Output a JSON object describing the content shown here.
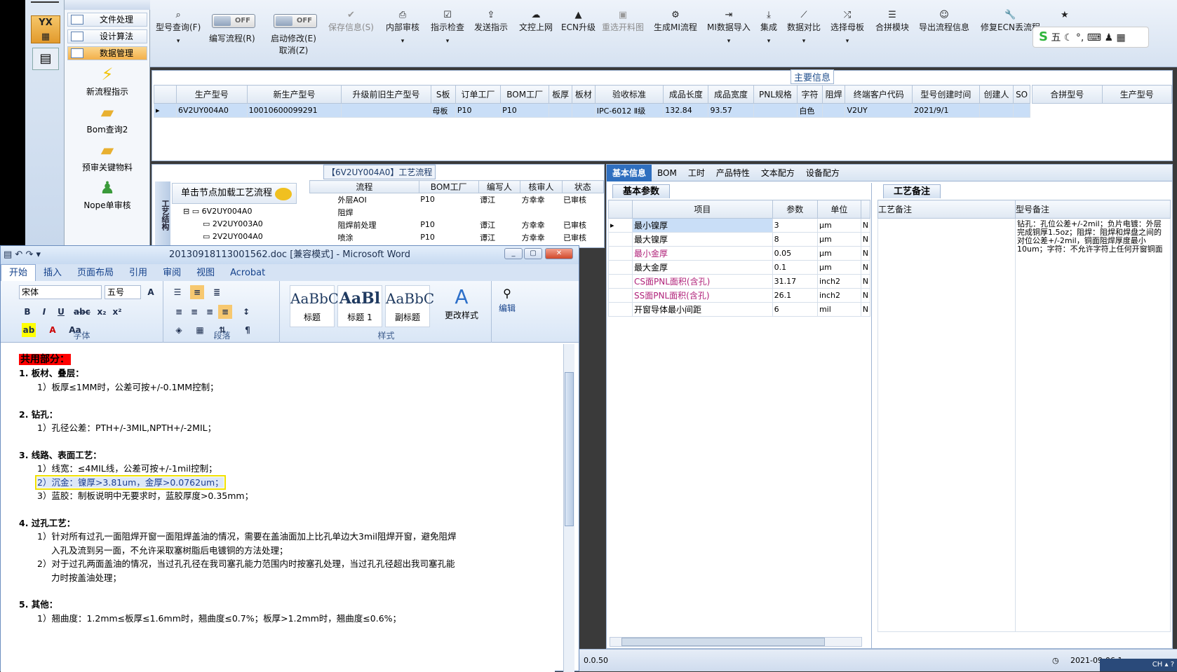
{
  "left_nav": {
    "items": [
      "文件处理",
      "设计算法",
      "数据管理"
    ],
    "active_index": 2,
    "big_items": [
      "新流程指示",
      "Bom查询2",
      "预审关键物料",
      "Nope单审核"
    ]
  },
  "toolbar": {
    "buttons": [
      {
        "label": "型号查询(F)",
        "icon": "search-icon",
        "disabled": false,
        "dropdown": true
      },
      {
        "label": "编写流程(R)",
        "icon": "toggle-icon",
        "disabled": false,
        "dropdown": false,
        "toggle": "OFF"
      },
      {
        "label": "启动修改(E)",
        "icon": "toggle-icon",
        "disabled": false,
        "dropdown": false,
        "toggle": "OFF",
        "sub": "取消(Z)"
      },
      {
        "label": "保存信息(S)",
        "icon": "check-icon",
        "disabled": true,
        "dropdown": false
      },
      {
        "label": "内部审核",
        "icon": "printer-icon",
        "disabled": false,
        "dropdown": true
      },
      {
        "label": "指示检查",
        "icon": "checkbox-icon",
        "disabled": false,
        "dropdown": true
      },
      {
        "label": "发送指示",
        "icon": "upload-icon",
        "disabled": false,
        "dropdown": false
      },
      {
        "label": "文控上网",
        "icon": "cloud-icon",
        "disabled": false,
        "dropdown": false
      },
      {
        "label": "ECN升级",
        "icon": "ecn-icon",
        "disabled": false,
        "dropdown": false
      },
      {
        "label": "重选开料图",
        "icon": "image-icon",
        "disabled": true,
        "dropdown": false
      },
      {
        "label": "生成MI流程",
        "icon": "gears-icon",
        "disabled": false,
        "dropdown": false
      },
      {
        "label": "MI数据导入",
        "icon": "import-icon",
        "disabled": false,
        "dropdown": true
      },
      {
        "label": "集成",
        "icon": "download-icon",
        "disabled": false,
        "dropdown": true
      },
      {
        "label": "数据对比",
        "icon": "compare-icon",
        "disabled": false,
        "dropdown": true
      },
      {
        "label": "选择母板",
        "icon": "shuffle-icon",
        "disabled": false,
        "dropdown": true
      },
      {
        "label": "合拼模块",
        "icon": "list-icon",
        "disabled": false,
        "dropdown": false
      },
      {
        "label": "导出流程信息",
        "icon": "smile-icon",
        "disabled": false,
        "dropdown": false
      },
      {
        "label": "修复ECN丢流程",
        "icon": "wrench-icon",
        "disabled": false,
        "dropdown": false
      },
      {
        "label": "",
        "icon": "star-icon",
        "disabled": false,
        "dropdown": true
      }
    ],
    "tray_text": "五"
  },
  "main_info": {
    "title": "主要信息",
    "columns": [
      "生产型号",
      "新生产型号",
      "升级前旧生产型号",
      "S板",
      "订单工厂",
      "BOM工厂",
      "板厚",
      "板材",
      "验收标准",
      "成品长度",
      "成品宽度",
      "PNL规格",
      "字符",
      "阻焊",
      "终端客户代码",
      "型号创建时间",
      "创建人",
      "SO"
    ],
    "row": [
      "6V2UY004A0",
      "10010600099291",
      "",
      "母板",
      "P10",
      "P10",
      "",
      "",
      "IPC-6012 Ⅱ级",
      "132.84",
      "93.57",
      "",
      "白色",
      "",
      "V2UY",
      "2021/9/1",
      "",
      ""
    ],
    "side_columns": [
      "合拼型号",
      "生产型号"
    ]
  },
  "flow": {
    "title": "【6V2UY004A0】工艺流程",
    "vertical_tab": "工艺结构",
    "load_button": "单击节点加载工艺流程",
    "tree": [
      "6V2UY004A0",
      "2V2UY003A0",
      "2V2UY004A0"
    ],
    "columns": [
      "流程",
      "BOM工厂",
      "编写人",
      "核审人",
      "状态"
    ],
    "rows": [
      {
        "name": "外层AOI",
        "factory": "P10",
        "writer": "谭江",
        "reviewer": "方幸幸",
        "status": "已审核"
      },
      {
        "name": "阻焊",
        "factory": "",
        "writer": "",
        "reviewer": "",
        "status": ""
      },
      {
        "name": "阻焊前处理",
        "factory": "P10",
        "writer": "谭江",
        "reviewer": "方幸幸",
        "status": "已审核"
      },
      {
        "name": "喷涂",
        "factory": "P10",
        "writer": "谭江",
        "reviewer": "方幸幸",
        "status": "已审核"
      }
    ]
  },
  "right": {
    "tabs": [
      "基本信息",
      "BOM",
      "工时",
      "产品特性",
      "文本配方",
      "设备配方"
    ],
    "active_tab": 0,
    "basic_title": "基本参数",
    "param_columns": [
      "项目",
      "参数",
      "单位"
    ],
    "params": [
      {
        "name": "最小镍厚",
        "value": "3",
        "unit": "μm",
        "flag": "N"
      },
      {
        "name": "最大镍厚",
        "value": "8",
        "unit": "μm",
        "flag": "N"
      },
      {
        "name": "最小金厚",
        "value": "0.05",
        "unit": "μm",
        "flag": "N"
      },
      {
        "name": "最大金厚",
        "value": "0.1",
        "unit": "μm",
        "flag": "N"
      },
      {
        "name": "CS面PNL面积(含孔)",
        "value": "31.17",
        "unit": "inch2",
        "flag": "N"
      },
      {
        "name": "SS面PNL面积(含孔)",
        "value": "26.1",
        "unit": "inch2",
        "flag": "N"
      },
      {
        "name": "开窗导体最小间距",
        "value": "6",
        "unit": "mil",
        "flag": "N"
      }
    ],
    "craft_title": "工艺备注",
    "craft_columns": [
      "工艺备注",
      "型号备注"
    ],
    "model_note": "钻孔：孔位公差+/-2mil；负片电镀：外层完成铜厚1.5oz；阻焊：阻焊和焊盘之间的对位公差+/-2mil，铜面阻焊厚度最小10um；字符：不允许字符上任何开窗铜面"
  },
  "word": {
    "title": "20130918113001562.doc [兼容模式] - Microsoft Word",
    "tabs": [
      "开始",
      "插入",
      "页面布局",
      "引用",
      "审阅",
      "视图",
      "Acrobat"
    ],
    "font": "宋体",
    "size": "五号",
    "groups": [
      "字体",
      "段落",
      "样式"
    ],
    "styles": [
      {
        "preview": "AaBbC",
        "name": "标题"
      },
      {
        "preview": "AaBl",
        "name": "标题 1"
      },
      {
        "preview": "AaBbC",
        "name": "副标题"
      }
    ],
    "change_style": "更改样式",
    "edit": "编辑",
    "doc": {
      "shared": "共用部分：",
      "sections": [
        {
          "heading": "1.  板材、叠层：",
          "lines": [
            "1）板厚≤1MM时，公差可按+/-0.1MM控制；"
          ]
        },
        {
          "heading": "2.  钻孔：",
          "lines": [
            "1）孔径公差：PTH+/-3MIL,NPTH+/-2MIL；"
          ]
        },
        {
          "heading": "3.  线路、表面工艺：",
          "lines": [
            "1）线宽：≤4MIL线，公差可按+/-1mil控制；",
            "2）沉金：镍厚>3.81um，金厚>0.0762um；",
            "3）蓝胶：制板说明中无要求时，蓝胶厚度>0.35mm；"
          ]
        },
        {
          "heading": "4.  过孔工艺：",
          "lines": [
            "1）针对所有过孔一面阻焊开窗一面阻焊盖油的情况，需要在盖油面加上比孔单边大3mil阻焊开窗，避免阻焊",
            "入孔及流到另一面，不允许采取塞树脂后电镀铜的方法处理；",
            "2）对于过孔两面盖油的情况，当过孔孔径在我司塞孔能力范围内时按塞孔处理，当过孔孔径超出我司塞孔能",
            "力时按盖油处理；"
          ]
        },
        {
          "heading": "5.  其他：",
          "lines": [
            "1）翘曲度：1.2mm≤板厚≤1.6mm时，翘曲度≤0.7%；板厚>1.2mm时，翘曲度≤0.6%；"
          ]
        }
      ]
    }
  },
  "status": {
    "version": "0.0.50",
    "datetime": "2021-09-06 1"
  },
  "taskbar": {
    "lang": "CH"
  }
}
